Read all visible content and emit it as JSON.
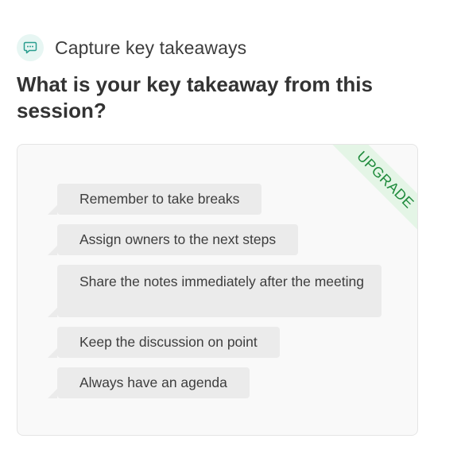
{
  "header": {
    "icon": "chat-bubble-icon",
    "label": "Capture key takeaways"
  },
  "question": "What is your key takeaway from this session?",
  "ribbon": {
    "label": "UPGRADE"
  },
  "takeaways": [
    "Remember to take breaks",
    "Assign owners to the next steps",
    "Share the notes immediately after the meeting",
    "Keep the discussion on point",
    "Always have an agenda"
  ],
  "colors": {
    "icon_bg": "#e7f6f3",
    "icon_stroke": "#2a9d8f",
    "ribbon_bg": "#e4f5e6",
    "ribbon_text": "#1f8b3c",
    "bubble_bg": "#ebebeb",
    "card_bg": "#f9f9f9"
  }
}
